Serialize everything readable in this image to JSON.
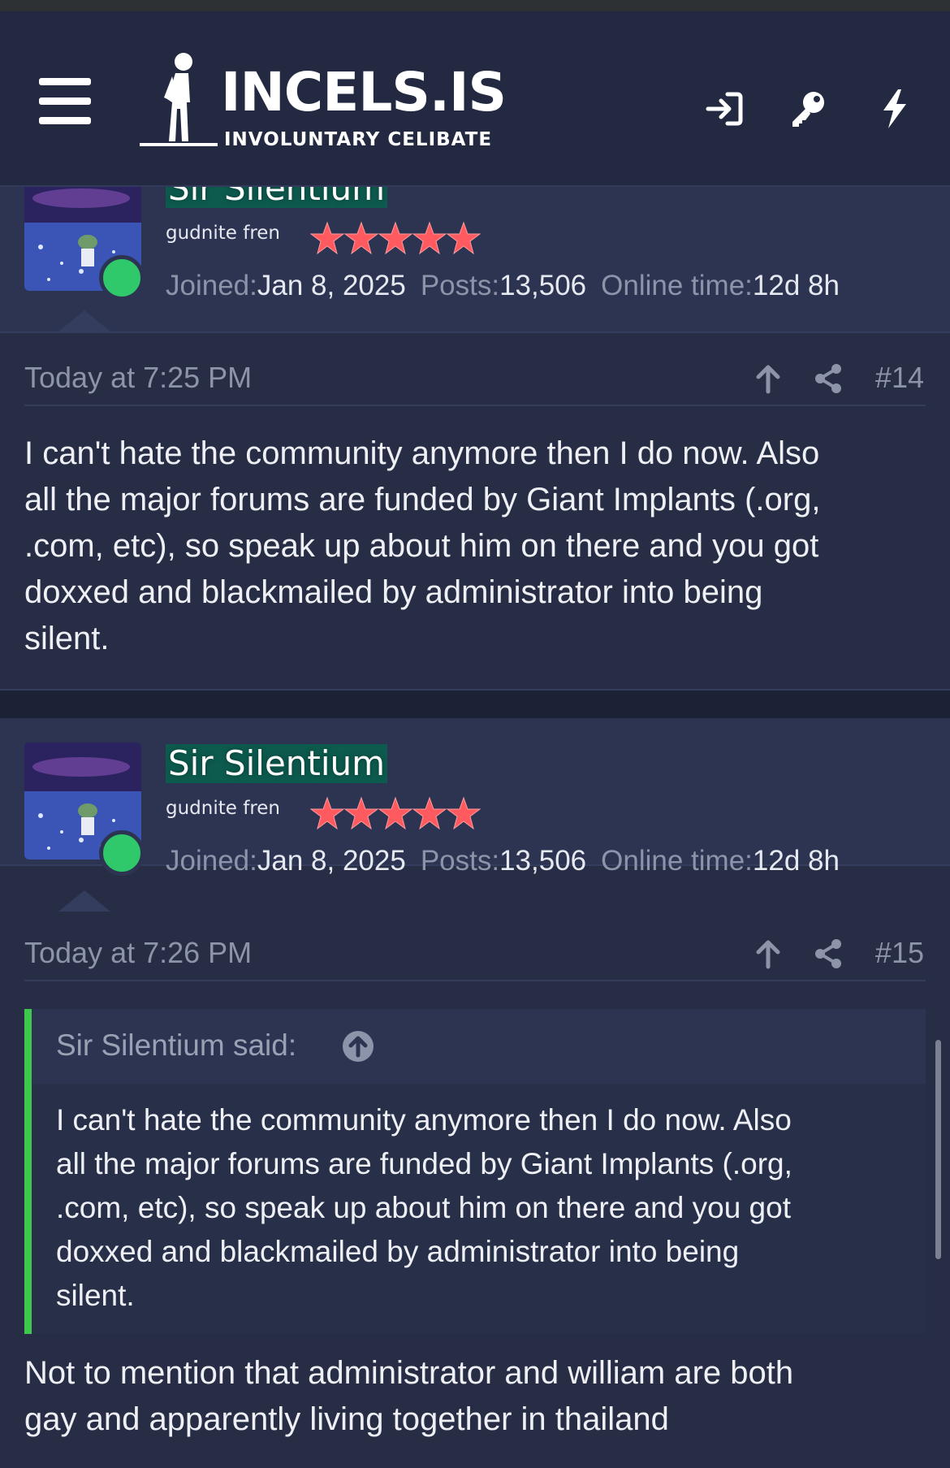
{
  "header": {
    "logo_title": "INCELS.IS",
    "logo_subtitle": "INVOLUNTARY CELIBATE",
    "icons": [
      "menu-icon",
      "login-icon",
      "key-icon",
      "lightning-icon"
    ]
  },
  "posts": [
    {
      "username": "Sir Silentium",
      "user_title": "gudnite fren",
      "rating_stars": 5,
      "joined_label": "Joined:",
      "joined": "Jan 8, 2025",
      "posts_label": "Posts:",
      "posts": "13,506",
      "online_label": "Online time:",
      "online_time": "12d 8h",
      "time": "Today at 7:25 PM",
      "number": "#14",
      "lines": [
        "I can't hate the community anymore then I do now. Also",
        "all the major forums are funded by Giant Implants (.org,",
        ".com, etc), so speak up about him on there and you got",
        "doxxed and blackmailed by administrator into being",
        "silent."
      ]
    },
    {
      "username": "Sir Silentium",
      "user_title": "gudnite fren",
      "rating_stars": 5,
      "joined_label": "Joined:",
      "joined": "Jan 8, 2025",
      "posts_label": "Posts:",
      "posts": "13,506",
      "online_label": "Online time:",
      "online_time": "12d 8h",
      "time": "Today at 7:26 PM",
      "number": "#15",
      "quote": {
        "attribution": "Sir Silentium said:",
        "lines": [
          "I can't hate the community anymore then I do now. Also",
          "all the major forums are funded by Giant Implants (.org,",
          ".com, etc), so speak up about him on there and you got",
          "doxxed and blackmailed by administrator into being",
          "silent."
        ]
      },
      "lines": [
        "Not to mention that administrator and william are both",
        "gay and apparently living together in thailand"
      ]
    }
  ],
  "colors": {
    "page_bg": "#262d44",
    "header_bg": "#222940",
    "user_block_bg": "#2c3452",
    "online_dot": "#2fc86a",
    "username_highlight": "#0d5a4e",
    "quote_border": "#3ec94e",
    "star": "#ff5a5f",
    "muted_text": "#8d94a9"
  }
}
